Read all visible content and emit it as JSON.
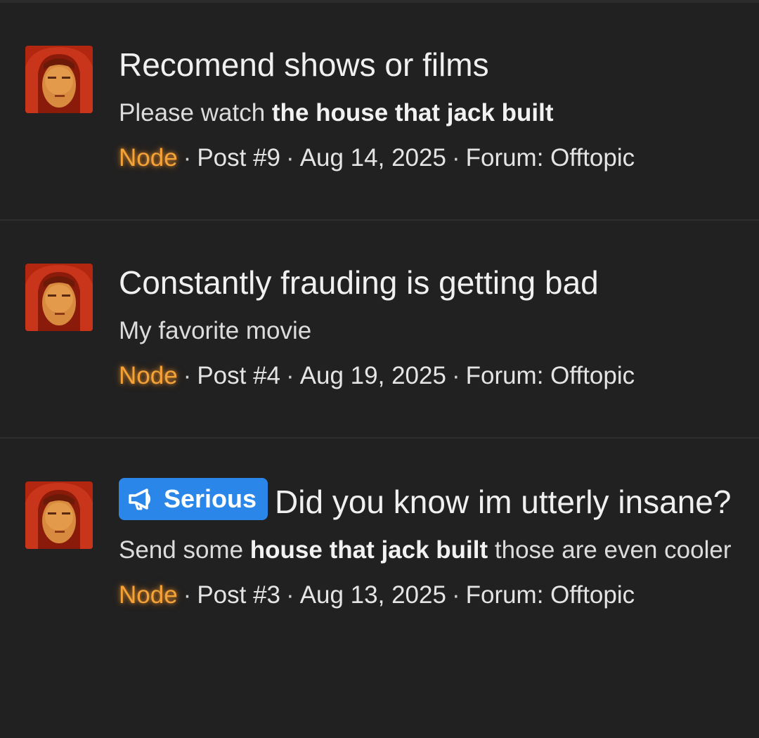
{
  "results": [
    {
      "title": "Recomend shows or films",
      "snippet_before": "Please watch ",
      "snippet_bold": "the house that jack built",
      "snippet_after": "",
      "user": "Node",
      "post": "Post #9",
      "date": "Aug 14, 2025",
      "forum": "Forum: Offtopic"
    },
    {
      "title": "Constantly frauding is getting bad",
      "snippet_before": "My favorite movie",
      "snippet_bold": "",
      "snippet_after": "",
      "user": "Node",
      "post": "Post #4",
      "date": "Aug 19, 2025",
      "forum": "Forum: Offtopic"
    },
    {
      "prefix": "Serious",
      "prefix_icon": "megaphone-icon",
      "title": "Did you know im utterly insane?",
      "snippet_before": "Send some ",
      "snippet_bold": "house that jack built",
      "snippet_after": " those are even cooler",
      "user": "Node",
      "post": "Post #3",
      "date": "Aug 13, 2025",
      "forum": "Forum: Offtopic"
    }
  ],
  "meta_separator": "·",
  "colors": {
    "background": "#212121",
    "username": "#f5a339",
    "prefix_badge": "#2a86e8"
  }
}
